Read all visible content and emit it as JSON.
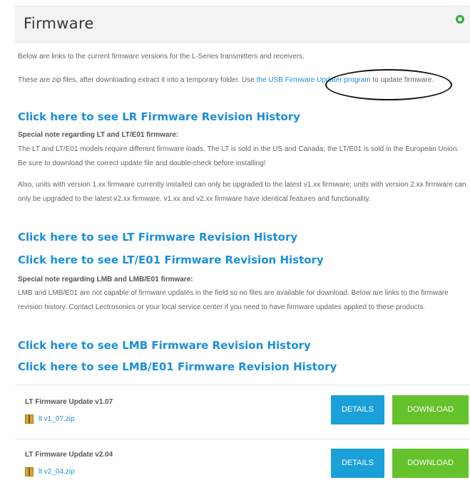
{
  "panel": {
    "title": "Firmware"
  },
  "intro": {
    "line1": "Below are links to the current firmware versions for the L-Series transmitters and receivers.",
    "line2_before": "These are zip files, after downloading extract it into a temporary folder. Use ",
    "line2_link": "the USB Firmware Updater program",
    "line2_after": " to update firmware."
  },
  "links": {
    "lr_history": "Click here to see LR Firmware Revision History",
    "lt_history": "Click here to see LT Firmware Revision History",
    "lte01_history": "Click here to see LT/E01 Firmware Revision History",
    "lmb_history": "Click here to see LMB Firmware Revision History",
    "lmbe01_history": "Click here to see LMB/E01 Firmware Revision History"
  },
  "note_lt": {
    "heading": "Special note regarding LT and LT/E01 firmware:",
    "para1": "The LT and LT/E01 models require different firmware loads. The LT is sold in the US and Canada; the LT/E01 is sold in the European Union. Be sure to download the correct update file and double-check before installing!",
    "para2": "Also, units with version 1.xx firmware currently installed can only be upgraded to the latest v1.xx firmware; units with version 2.xx firmware can only be upgraded to the latest v2.xx firmware. v1.xx and v2.xx firmware have identical features and functionality."
  },
  "note_lmb": {
    "heading": "Special note regarding LMB and LMB/E01 firmware:",
    "para": "LMB and LMB/E01 are not capable of firmware updates in the field so no files are available for download. Below are links to the firmware revision history. Contact Lectrosonics or your local service center if you need to have firmware updates applied to these products."
  },
  "downloads": [
    {
      "title": "LT Firmware Update v1.07",
      "file": "lt v1_07.zip",
      "details": "DETAILS",
      "download": "DOWNLOAD"
    },
    {
      "title": "LT Firmware Update v2.04",
      "file": "lt v2_04.zip",
      "details": "DETAILS",
      "download": "DOWNLOAD"
    }
  ],
  "colors": {
    "link": "#1b8fdb",
    "details_button": "#1aa0d8",
    "download_button": "#66c22c",
    "header_bg": "#f3f3f3"
  }
}
